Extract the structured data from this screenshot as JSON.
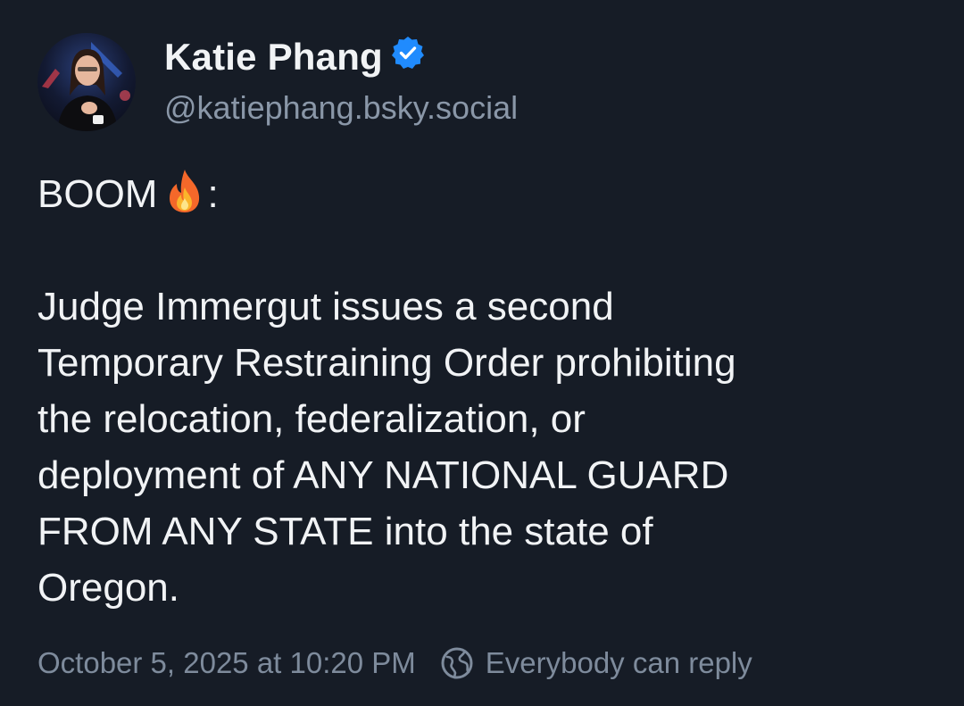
{
  "author": {
    "display_name": "Katie Phang",
    "handle": "@katiephang.bsky.social",
    "verified": true,
    "avatar_icon": "profile-photo"
  },
  "post": {
    "line1_text": "BOOM",
    "line1_emoji": "fire-emoji",
    "line1_suffix": ":",
    "paragraph": [
      "Judge Immergut issues a second",
      "Temporary Restraining Order prohibiting",
      "the relocation, federalization, or",
      "deployment of ANY NATIONAL GUARD",
      "FROM ANY STATE into the state of",
      "Oregon."
    ]
  },
  "footer": {
    "timestamp": "October 5, 2025 at 10:20 PM",
    "reply_icon": "globe-icon",
    "reply_setting": "Everybody can reply"
  },
  "colors": {
    "background": "#161c26",
    "text": "#f1f3f5",
    "muted": "#8a97a8",
    "verified_badge": "#208bfe"
  }
}
